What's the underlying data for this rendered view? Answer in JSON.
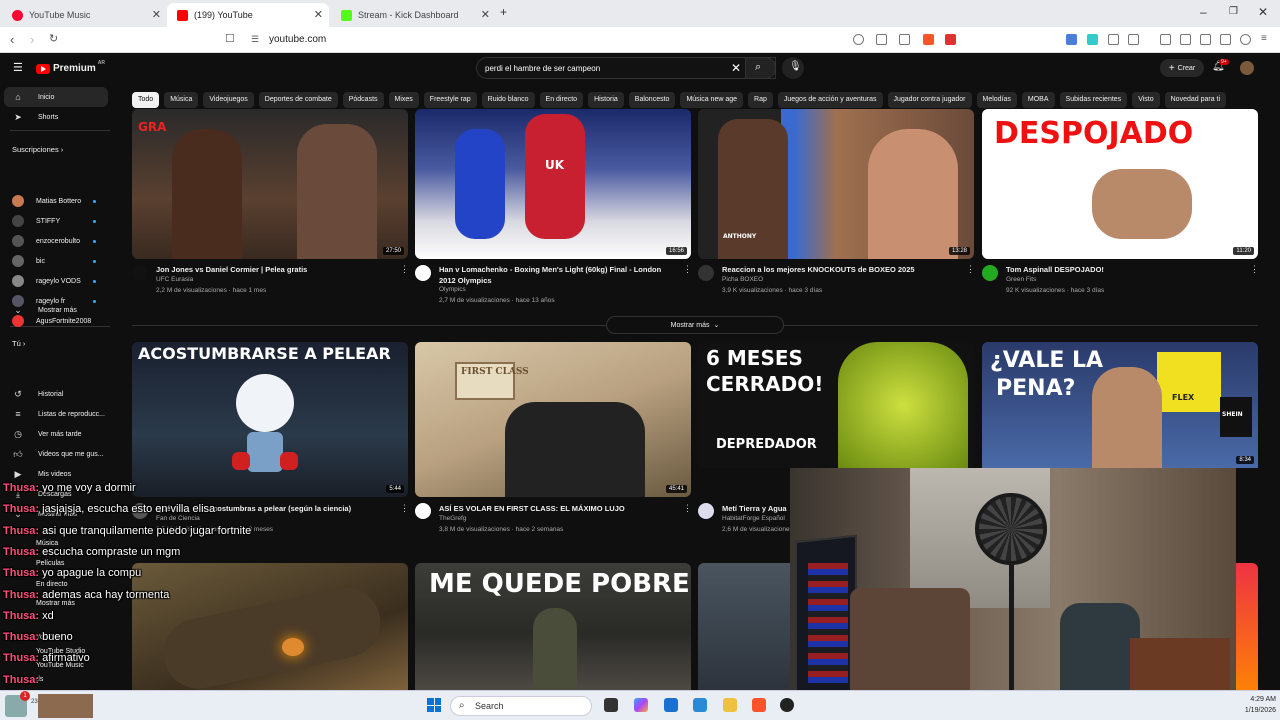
{
  "browser": {
    "tabs": [
      {
        "label": "YouTube Music",
        "color": "#ff0033"
      },
      {
        "label": "(199) YouTube",
        "color": "#ff0000"
      },
      {
        "label": "Stream - Kick Dashboard",
        "color": "#53fc18"
      }
    ],
    "url": "youtube.com"
  },
  "youtube": {
    "logo": "Premium",
    "region": "AR",
    "search_value": "perdi el hambre de ser campeon",
    "create_label": "Crear",
    "notif_count": "9+",
    "chips": [
      "Todo",
      "Música",
      "Videojuegos",
      "Deportes de combate",
      "Pódcasts",
      "Mixes",
      "Freestyle rap",
      "Ruido blanco",
      "En directo",
      "Historia",
      "Baloncesto",
      "Música new age",
      "Rap",
      "Juegos de acción y aventuras",
      "Jugador contra jugador",
      "Melodías",
      "MOBA",
      "Subidas recientes",
      "Visto",
      "Novedad para ti"
    ],
    "sidebar": {
      "main": [
        "Inicio",
        "Shorts"
      ],
      "subs_header": "Suscripciones",
      "subs": [
        "Matias Bottero",
        "STIFFY",
        "enzocerobulto",
        "bic",
        "rageylo VODS",
        "rageylo fr",
        "AgusFortnite2008"
      ],
      "show_more": "Mostrar más",
      "you_header": "Tú",
      "you": [
        "Historial",
        "Listas de reproducc...",
        "Ver más tarde",
        "Videos que me gus...",
        "Mis videos",
        "Descargas",
        "Mostrar más"
      ]
    },
    "videos_row1": [
      {
        "title": "Jon Jones vs Daniel Cormier | Pelea gratis",
        "channel": "UFC Eurasia",
        "views": "2,2 M de visualizaciones · hace 1 mes",
        "duration": "27:50",
        "overlay": "GRA"
      },
      {
        "title": "Han v Lomachenko - Boxing Men's Light (60kg) Final - London 2012 Olympics",
        "channel": "Olympics",
        "views": "2,7 M de visualizaciones · hace 13 años",
        "duration": "16:56",
        "overlay": "UK"
      },
      {
        "title": "Reaccion a los mejores KNOCKOUTS de BOXEO 2025",
        "channel": "Picha BOXEO",
        "views": "3,9 K visualizaciones · hace 3 días",
        "duration": "13:28",
        "overlay": "ANTHONY"
      },
      {
        "title": "Tom Aspinall DESPOJADO!",
        "channel": "Green Fits",
        "views": "92 K visualizaciones · hace 3 días",
        "duration": "11:20",
        "overlay": "DESPOJADO"
      }
    ],
    "show_more_row": "Mostrar más",
    "videos_row2": [
      {
        "title": "Qué pasa si te acostumbras a pelear (según la ciencia)",
        "channel": "Fan de Ciencia",
        "views": "2,5 M de visualizaciones · hace 3 meses",
        "duration": "5:44",
        "overlay": "ACOSTUMBRARSE A PELEAR"
      },
      {
        "title": "ASÍ ES VOLAR EN FIRST CLASS: EL MÁXIMO LUJO",
        "channel": "TheGrefg",
        "views": "3,8 M de visualizaciones · hace 2 semanas",
        "duration": "45:41",
        "overlay": "FIRST CLASS"
      },
      {
        "title": "Metí Tierra y Agua",
        "channel": "HabitatForge Español",
        "views": "2,6 M de visualizaciones",
        "duration": "",
        "overlay1": "6 MESES",
        "overlay2": "CERRADO!",
        "overlay3": "DEPREDADOR"
      },
      {
        "title": "",
        "channel": "",
        "views": "",
        "duration": "8:34",
        "overlay1": "¿VALE LA",
        "overlay2": "PENA?",
        "overlay3": "FLEX",
        "overlay4": "SHEIN"
      }
    ],
    "row3_overlay": "ME QUEDE POBRE"
  },
  "chat": [
    {
      "user": "Thusa:",
      "msg": "yo me voy a dormir"
    },
    {
      "user": "Thusa:",
      "msg": "jasjajsja, escucha esto en villa elisa"
    },
    {
      "user": "Thusa:",
      "msg": "asi que tranquilamente puedo jugar fortnite"
    },
    {
      "user": "Thusa:",
      "msg": "escucha compraste un mgm"
    },
    {
      "user": "Thusa:",
      "msg": "yo apague la compu"
    },
    {
      "user": "Thusa:",
      "msg": "ademas aca hay tormenta"
    },
    {
      "user": "Thusa:",
      "msg": "xd"
    },
    {
      "user": "Thusa:",
      "msg": "bueno"
    },
    {
      "user": "Thusa:",
      "msg": "afirmativo"
    },
    {
      "user": "Thusa:",
      "msg": ""
    }
  ],
  "behind_chat": [
    "Música",
    "Películas",
    "En directo",
    "Mostrar más",
    "YouTube",
    "YouTube Studio",
    "YouTube Music",
    "ds"
  ],
  "taskbar": {
    "search": "Search",
    "time": "4:29 AM",
    "date": "1/19/2026",
    "weather": "23°C"
  }
}
